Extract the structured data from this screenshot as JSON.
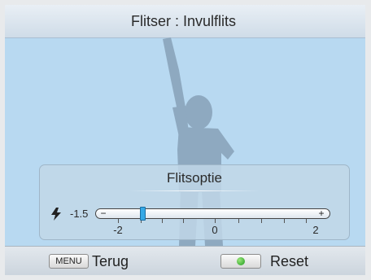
{
  "title": "Flitser : Invulflits",
  "panel": {
    "title": "Flitsoptie",
    "icon": "flash-icon",
    "current_value": "-1.5",
    "slider": {
      "min": -2,
      "max": 2,
      "value": -1.5,
      "minus_symbol": "−",
      "plus_symbol": "+",
      "scale_labels": [
        "-2",
        "0",
        "2"
      ]
    }
  },
  "footer": {
    "menu_key": "MENU",
    "back_label": "Terug",
    "ok_key_color": "#2fbf2f",
    "reset_label": "Reset"
  },
  "colors": {
    "background": "#b8d9f1",
    "slider_thumb": "#36a9e6"
  }
}
